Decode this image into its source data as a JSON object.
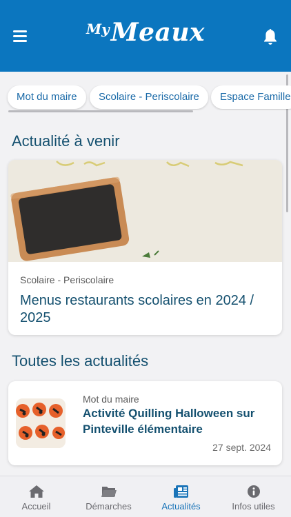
{
  "header": {
    "logo_prefix": "My",
    "logo_city": "Meaux",
    "brand_color": "#0b76bf",
    "menu_icon": "hamburger-icon",
    "notification_icon": "bell-icon"
  },
  "categories": [
    {
      "label": "Mot du maire"
    },
    {
      "label": "Scolaire - Periscolaire"
    },
    {
      "label": "Espace Famille"
    }
  ],
  "upcoming": {
    "section_title": "Actualité à venir",
    "card": {
      "category": "Scolaire - Periscolaire",
      "title": "Menus restaurants scolaires en 2024 / 2025",
      "image": "chalkboard-image"
    }
  },
  "all_news": {
    "section_title": "Toutes les actualités",
    "items": [
      {
        "category": "Mot du maire",
        "title": "Activité Quilling Halloween sur Pinteville élémentaire",
        "date": "27 sept. 2024",
        "image": "halloween-quilling-image"
      }
    ]
  },
  "bottom_nav": {
    "active_color": "#1a74b8",
    "items": [
      {
        "label": "Accueil",
        "icon": "home-icon"
      },
      {
        "label": "Démarches",
        "icon": "folder-icon"
      },
      {
        "label": "Actualités",
        "icon": "newspaper-icon",
        "active": true
      },
      {
        "label": "Infos utiles",
        "icon": "info-icon"
      }
    ]
  }
}
